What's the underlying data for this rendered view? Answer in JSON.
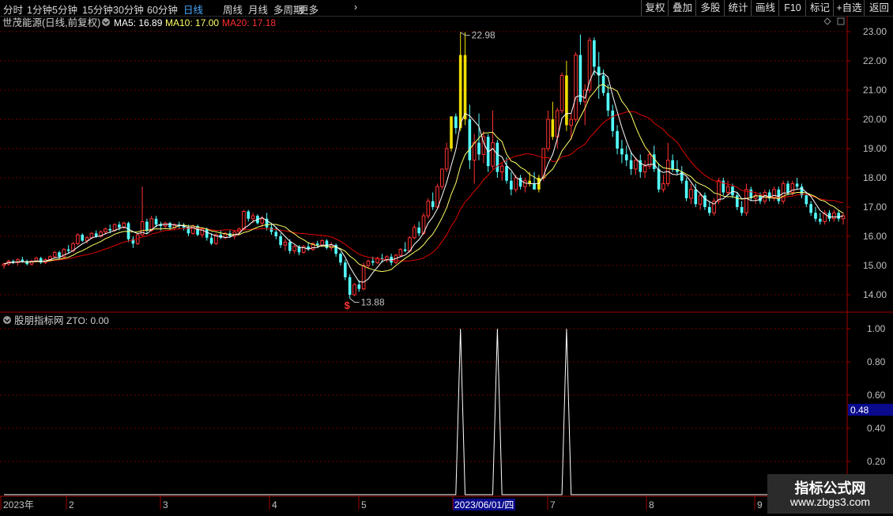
{
  "toolbar": {
    "tabs": [
      "分时",
      "1分钟",
      "5分钟",
      "15分钟",
      "30分钟",
      "60分钟",
      "日线",
      "周线",
      "月线",
      "多周期",
      "更多"
    ],
    "active_tab": "日线",
    "more_arrow": "›",
    "right_buttons": [
      "复权",
      "叠加",
      "多股",
      "统计",
      "画线",
      "F10",
      "标记",
      "+自选",
      "返回"
    ]
  },
  "main_chart": {
    "title": "世茂能源(日线,前复权)",
    "ma5_label": "MA5: 16.89",
    "ma10_label": "MA10: 17.00",
    "ma20_label": "MA20: 17.18",
    "high_label": "22.98",
    "low_label": "13.88",
    "signal_mark": "$",
    "y_ticks": [
      "23.00",
      "22.00",
      "21.00",
      "20.00",
      "19.00",
      "18.00",
      "17.00",
      "16.00",
      "15.00",
      "14.00"
    ],
    "colors": {
      "up": "#ff3232",
      "down": "#54ffff",
      "limit_up": "#f0e000",
      "ma5": "#ffffff",
      "ma10": "#ffff66",
      "ma20": "#e00000",
      "grid": "#6b0000",
      "axis": "#a00000",
      "label": "#c0c0c0"
    }
  },
  "indicator": {
    "title": "股朋指标网",
    "zto_label": "ZTO: 0.00",
    "y_ticks": [
      "1.00",
      "0.80",
      "0.60",
      "0.40",
      "0.20"
    ],
    "current_value": "0.48"
  },
  "date_axis": {
    "labels": [
      "2023年",
      "2",
      "3",
      "4",
      "5",
      "2023/06/01/四",
      "7",
      "8",
      "9"
    ]
  },
  "watermark": {
    "line1": "指标公式网",
    "line2": "www.zbgs3.com"
  },
  "chart_data": {
    "type": "candlestick",
    "title": "世茂能源(日线,前复权)",
    "ylim": [
      13.6,
      23.3
    ],
    "y_ticks": [
      23,
      22,
      21,
      20,
      19,
      18,
      17,
      16,
      15,
      14
    ],
    "ohlc": [
      [
        15.0,
        15.1,
        14.9,
        15.05
      ],
      [
        15.05,
        15.2,
        15.0,
        15.15
      ],
      [
        15.15,
        15.2,
        15.05,
        15.1
      ],
      [
        15.1,
        15.25,
        15.0,
        15.2
      ],
      [
        15.2,
        15.3,
        15.1,
        15.15
      ],
      [
        15.15,
        15.2,
        15.0,
        15.05
      ],
      [
        15.05,
        15.2,
        15.0,
        15.15
      ],
      [
        15.15,
        15.3,
        15.1,
        15.25
      ],
      [
        15.25,
        15.3,
        15.05,
        15.1
      ],
      [
        15.1,
        15.25,
        15.05,
        15.2
      ],
      [
        15.2,
        15.35,
        15.15,
        15.3
      ],
      [
        15.3,
        15.5,
        15.25,
        15.45
      ],
      [
        15.45,
        15.5,
        15.2,
        15.3
      ],
      [
        15.3,
        15.6,
        15.25,
        15.55
      ],
      [
        15.55,
        15.7,
        15.4,
        15.5
      ],
      [
        15.5,
        15.8,
        15.45,
        15.75
      ],
      [
        15.75,
        16.1,
        15.7,
        16.05
      ],
      [
        16.05,
        16.1,
        15.8,
        15.85
      ],
      [
        15.85,
        16.0,
        15.75,
        15.95
      ],
      [
        15.95,
        16.15,
        15.9,
        16.1
      ],
      [
        16.1,
        16.2,
        15.95,
        16.0
      ],
      [
        16.0,
        16.2,
        15.95,
        16.15
      ],
      [
        16.15,
        16.3,
        16.05,
        16.25
      ],
      [
        16.25,
        16.4,
        16.1,
        16.2
      ],
      [
        16.2,
        16.45,
        16.15,
        16.4
      ],
      [
        16.4,
        16.5,
        16.2,
        16.3
      ],
      [
        16.3,
        16.5,
        16.25,
        16.45
      ],
      [
        16.45,
        16.5,
        15.8,
        15.9
      ],
      [
        15.9,
        16.0,
        15.6,
        15.75
      ],
      [
        15.75,
        16.1,
        15.7,
        16.05
      ],
      [
        16.05,
        17.7,
        16.0,
        16.5
      ],
      [
        16.5,
        16.6,
        16.1,
        16.2
      ],
      [
        16.2,
        16.7,
        16.15,
        16.6
      ],
      [
        16.6,
        16.7,
        16.3,
        16.4
      ],
      [
        16.4,
        16.5,
        16.2,
        16.35
      ],
      [
        16.35,
        16.5,
        16.25,
        16.45
      ],
      [
        16.45,
        16.5,
        16.2,
        16.3
      ],
      [
        16.3,
        16.45,
        16.2,
        16.4
      ],
      [
        16.4,
        16.5,
        16.25,
        16.35
      ],
      [
        16.35,
        16.45,
        16.2,
        16.3
      ],
      [
        16.3,
        16.4,
        16.0,
        16.1
      ],
      [
        16.1,
        16.4,
        16.05,
        16.35
      ],
      [
        16.35,
        16.4,
        16.0,
        16.05
      ],
      [
        16.05,
        16.3,
        15.95,
        16.25
      ],
      [
        16.25,
        16.3,
        15.85,
        15.95
      ],
      [
        15.95,
        16.1,
        15.7,
        15.75
      ],
      [
        15.75,
        16.1,
        15.7,
        16.05
      ],
      [
        16.05,
        16.2,
        15.9,
        15.95
      ],
      [
        15.95,
        16.15,
        15.9,
        16.1
      ],
      [
        16.1,
        16.2,
        15.95,
        16.0
      ],
      [
        16.0,
        16.2,
        15.9,
        16.15
      ],
      [
        16.15,
        16.3,
        16.05,
        16.25
      ],
      [
        16.25,
        16.9,
        16.2,
        16.85
      ],
      [
        16.85,
        16.9,
        16.5,
        16.6
      ],
      [
        16.6,
        16.8,
        16.45,
        16.7
      ],
      [
        16.7,
        16.75,
        16.4,
        16.45
      ],
      [
        16.45,
        16.7,
        16.3,
        16.6
      ],
      [
        16.6,
        16.8,
        16.2,
        16.3
      ],
      [
        16.3,
        16.4,
        16.05,
        16.15
      ],
      [
        16.15,
        16.3,
        15.9,
        16.0
      ],
      [
        16.0,
        16.1,
        15.6,
        15.7
      ],
      [
        15.7,
        15.9,
        15.5,
        15.8
      ],
      [
        15.8,
        15.9,
        15.4,
        15.5
      ],
      [
        15.5,
        15.7,
        15.4,
        15.65
      ],
      [
        15.65,
        15.7,
        15.35,
        15.45
      ],
      [
        15.45,
        15.7,
        15.4,
        15.65
      ],
      [
        15.65,
        15.8,
        15.5,
        15.55
      ],
      [
        15.55,
        15.8,
        15.5,
        15.75
      ],
      [
        15.75,
        15.85,
        15.6,
        15.7
      ],
      [
        15.7,
        15.9,
        15.65,
        15.85
      ],
      [
        15.85,
        15.9,
        15.55,
        15.6
      ],
      [
        15.6,
        15.8,
        15.5,
        15.7
      ],
      [
        15.7,
        15.75,
        15.3,
        15.4
      ],
      [
        15.4,
        15.45,
        15.0,
        15.1
      ],
      [
        15.1,
        15.2,
        14.5,
        14.6
      ],
      [
        14.6,
        14.7,
        13.88,
        14.0
      ],
      [
        14.0,
        14.4,
        13.95,
        14.35
      ],
      [
        14.35,
        14.5,
        14.1,
        14.2
      ],
      [
        14.2,
        15.1,
        14.15,
        15.0
      ],
      [
        15.0,
        15.2,
        14.9,
        15.15
      ],
      [
        15.15,
        15.3,
        15.0,
        15.1
      ],
      [
        15.1,
        15.3,
        15.05,
        15.25
      ],
      [
        15.25,
        15.4,
        15.1,
        15.2
      ],
      [
        15.2,
        15.35,
        15.1,
        15.3
      ],
      [
        15.3,
        15.4,
        15.0,
        15.1
      ],
      [
        15.1,
        15.4,
        15.05,
        15.35
      ],
      [
        15.35,
        15.6,
        15.3,
        15.55
      ],
      [
        15.55,
        15.8,
        15.45,
        15.5
      ],
      [
        15.5,
        16.0,
        15.45,
        15.95
      ],
      [
        15.95,
        16.4,
        15.9,
        16.3
      ],
      [
        16.3,
        16.5,
        16.0,
        16.1
      ],
      [
        16.1,
        16.8,
        16.05,
        16.7
      ],
      [
        16.7,
        17.3,
        16.6,
        17.2
      ],
      [
        17.2,
        17.5,
        16.9,
        17.0
      ],
      [
        17.0,
        17.8,
        16.95,
        17.7
      ],
      [
        17.7,
        18.3,
        17.6,
        18.3
      ],
      [
        18.3,
        19.2,
        18.2,
        19.0
      ],
      [
        19.0,
        20.1,
        18.9,
        20.1
      ],
      [
        20.1,
        20.2,
        19.5,
        19.7
      ],
      [
        19.7,
        22.98,
        19.6,
        22.2
      ],
      [
        22.2,
        22.98,
        19.8,
        20.0
      ],
      [
        20.0,
        20.5,
        18.3,
        18.6
      ],
      [
        18.6,
        19.5,
        17.8,
        19.2
      ],
      [
        19.2,
        20.2,
        18.6,
        18.8
      ],
      [
        18.8,
        19.6,
        18.5,
        19.4
      ],
      [
        19.4,
        19.5,
        18.2,
        18.4
      ],
      [
        18.4,
        20.3,
        18.3,
        19.2
      ],
      [
        19.2,
        19.3,
        18.0,
        18.2
      ],
      [
        18.2,
        18.5,
        17.9,
        18.4
      ],
      [
        18.4,
        18.7,
        17.8,
        17.9
      ],
      [
        17.9,
        18.2,
        17.4,
        17.6
      ],
      [
        17.6,
        18.1,
        17.5,
        18.0
      ],
      [
        18.0,
        18.1,
        17.6,
        17.7
      ],
      [
        17.7,
        18.0,
        17.5,
        17.9
      ],
      [
        17.9,
        18.2,
        17.7,
        17.8
      ],
      [
        17.8,
        18.2,
        17.6,
        17.6
      ],
      [
        17.6,
        18.1,
        17.5,
        18.0
      ],
      [
        18.0,
        19.0,
        17.9,
        19.0
      ],
      [
        19.0,
        20.3,
        18.9,
        20.0
      ],
      [
        20.0,
        20.6,
        19.3,
        19.4
      ],
      [
        19.4,
        20.4,
        19.0,
        20.3
      ],
      [
        20.3,
        21.6,
        20.2,
        21.5
      ],
      [
        21.5,
        22.0,
        19.6,
        19.8
      ],
      [
        19.8,
        20.2,
        19.3,
        20.0
      ],
      [
        20.0,
        22.3,
        19.9,
        22.2
      ],
      [
        22.2,
        22.9,
        20.5,
        20.6
      ],
      [
        20.6,
        21.2,
        19.8,
        21.0
      ],
      [
        21.0,
        22.8,
        20.9,
        22.7
      ],
      [
        22.7,
        22.8,
        21.5,
        21.8
      ],
      [
        21.8,
        22.3,
        20.7,
        21.5
      ],
      [
        21.5,
        21.7,
        20.8,
        20.9
      ],
      [
        20.9,
        21.2,
        20.1,
        20.3
      ],
      [
        20.3,
        20.5,
        19.4,
        19.6
      ],
      [
        19.6,
        19.8,
        18.8,
        19.0
      ],
      [
        19.0,
        19.3,
        18.5,
        18.8
      ],
      [
        18.8,
        19.1,
        18.4,
        18.6
      ],
      [
        18.6,
        18.9,
        18.1,
        18.3
      ],
      [
        18.3,
        18.7,
        18.1,
        18.6
      ],
      [
        18.6,
        18.8,
        18.0,
        18.2
      ],
      [
        18.2,
        18.6,
        18.0,
        18.4
      ],
      [
        18.4,
        18.9,
        18.3,
        18.8
      ],
      [
        18.8,
        19.1,
        18.2,
        18.3
      ],
      [
        18.3,
        18.5,
        17.5,
        17.6
      ],
      [
        17.6,
        18.1,
        17.5,
        17.8
      ],
      [
        17.8,
        19.2,
        17.7,
        18.6
      ],
      [
        18.6,
        18.8,
        18.2,
        18.3
      ],
      [
        18.3,
        18.6,
        18.1,
        18.2
      ],
      [
        18.2,
        18.4,
        17.8,
        17.9
      ],
      [
        17.9,
        18.0,
        17.2,
        17.3
      ],
      [
        17.3,
        17.8,
        17.1,
        17.6
      ],
      [
        17.6,
        17.8,
        17.0,
        17.1
      ],
      [
        17.1,
        17.5,
        16.9,
        17.4
      ],
      [
        17.4,
        17.5,
        16.9,
        17.0
      ],
      [
        17.0,
        17.2,
        16.7,
        16.8
      ],
      [
        16.8,
        17.3,
        16.7,
        17.2
      ],
      [
        17.2,
        18.0,
        17.1,
        17.9
      ],
      [
        17.9,
        18.0,
        17.4,
        17.5
      ],
      [
        17.5,
        17.9,
        17.4,
        17.7
      ],
      [
        17.7,
        17.8,
        17.3,
        17.4
      ],
      [
        17.4,
        17.5,
        16.9,
        17.0
      ],
      [
        17.0,
        17.2,
        16.7,
        16.8
      ],
      [
        16.8,
        17.8,
        16.7,
        17.6
      ],
      [
        17.6,
        17.7,
        17.2,
        17.3
      ],
      [
        17.3,
        17.5,
        17.1,
        17.4
      ],
      [
        17.4,
        17.5,
        17.1,
        17.2
      ],
      [
        17.2,
        17.6,
        17.1,
        17.5
      ],
      [
        17.5,
        17.6,
        17.2,
        17.3
      ],
      [
        17.3,
        17.7,
        17.2,
        17.6
      ],
      [
        17.6,
        17.7,
        17.1,
        17.2
      ],
      [
        17.2,
        17.9,
        17.1,
        17.8
      ],
      [
        17.8,
        17.9,
        17.4,
        17.5
      ],
      [
        17.5,
        17.9,
        17.4,
        17.8
      ],
      [
        17.8,
        18.0,
        17.6,
        17.7
      ],
      [
        17.7,
        17.8,
        17.3,
        17.4
      ],
      [
        17.4,
        17.5,
        17.0,
        17.1
      ],
      [
        17.1,
        17.2,
        16.7,
        16.8
      ],
      [
        16.8,
        17.0,
        16.5,
        16.6
      ],
      [
        16.6,
        16.8,
        16.4,
        16.5
      ],
      [
        16.5,
        16.9,
        16.4,
        16.8
      ],
      [
        16.8,
        16.9,
        16.5,
        16.6
      ],
      [
        16.6,
        16.9,
        16.5,
        16.8
      ],
      [
        16.8,
        16.9,
        16.5,
        16.6
      ],
      [
        16.6,
        16.8,
        16.4,
        16.7
      ]
    ],
    "limit_up_days": [
      97,
      99,
      100,
      114,
      116,
      119,
      122
    ],
    "zto_spikes": [
      99,
      107,
      122
    ],
    "indicator_ylim": [
      0,
      1.1
    ]
  }
}
